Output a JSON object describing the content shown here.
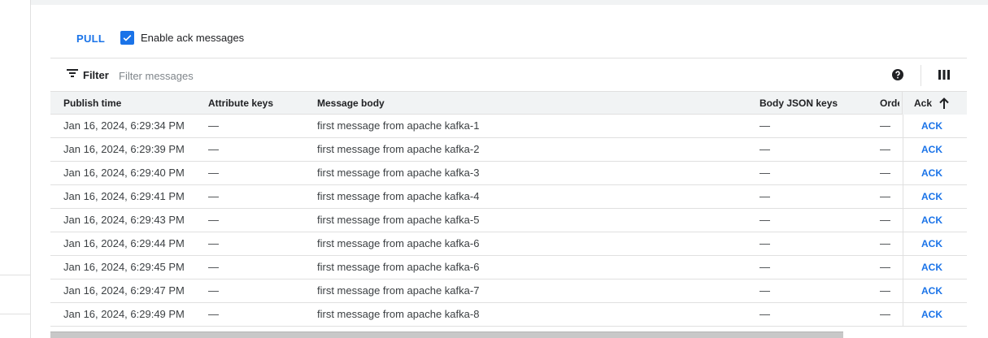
{
  "toolbar": {
    "pull_label": "PULL",
    "enable_ack_label": "Enable ack messages",
    "enable_ack_checked": true
  },
  "filter": {
    "label": "Filter",
    "placeholder": "Filter messages",
    "help_icon": "help-circle-icon",
    "columns_icon": "column-display-icon"
  },
  "table": {
    "headers": {
      "publish_time": "Publish time",
      "attribute_keys": "Attribute keys",
      "message_body": "Message body",
      "body_json_keys": "Body JSON keys",
      "ordering": "Orde",
      "ack": "Ack"
    },
    "sort": {
      "column": "ack",
      "direction": "ascending",
      "icon": "arrow-up-icon"
    },
    "rows": [
      {
        "publish_time": "Jan 16, 2024, 6:29:34 PM",
        "attribute_keys": "—",
        "message_body": "first message from apache kafka-1",
        "body_json_keys": "—",
        "ordering": "—",
        "ack": "ACK"
      },
      {
        "publish_time": "Jan 16, 2024, 6:29:39 PM",
        "attribute_keys": "—",
        "message_body": "first message from apache kafka-2",
        "body_json_keys": "—",
        "ordering": "—",
        "ack": "ACK"
      },
      {
        "publish_time": "Jan 16, 2024, 6:29:40 PM",
        "attribute_keys": "—",
        "message_body": "first message from apache kafka-3",
        "body_json_keys": "—",
        "ordering": "—",
        "ack": "ACK"
      },
      {
        "publish_time": "Jan 16, 2024, 6:29:41 PM",
        "attribute_keys": "—",
        "message_body": "first message from apache kafka-4",
        "body_json_keys": "—",
        "ordering": "—",
        "ack": "ACK"
      },
      {
        "publish_time": "Jan 16, 2024, 6:29:43 PM",
        "attribute_keys": "—",
        "message_body": "first message from apache kafka-5",
        "body_json_keys": "—",
        "ordering": "—",
        "ack": "ACK"
      },
      {
        "publish_time": "Jan 16, 2024, 6:29:44 PM",
        "attribute_keys": "—",
        "message_body": "first message from apache kafka-6",
        "body_json_keys": "—",
        "ordering": "—",
        "ack": "ACK"
      },
      {
        "publish_time": "Jan 16, 2024, 6:29:45 PM",
        "attribute_keys": "—",
        "message_body": "first message from apache kafka-6",
        "body_json_keys": "—",
        "ordering": "—",
        "ack": "ACK"
      },
      {
        "publish_time": "Jan 16, 2024, 6:29:47 PM",
        "attribute_keys": "—",
        "message_body": "first message from apache kafka-7",
        "body_json_keys": "—",
        "ordering": "—",
        "ack": "ACK"
      },
      {
        "publish_time": "Jan 16, 2024, 6:29:49 PM",
        "attribute_keys": "—",
        "message_body": "first message from apache kafka-8",
        "body_json_keys": "—",
        "ordering": "—",
        "ack": "ACK"
      }
    ]
  },
  "colors": {
    "accent": "#1a73e8",
    "header_bg": "#f1f3f4",
    "divider": "#e0e0e0",
    "scrollbar": "#c8c8c8"
  }
}
